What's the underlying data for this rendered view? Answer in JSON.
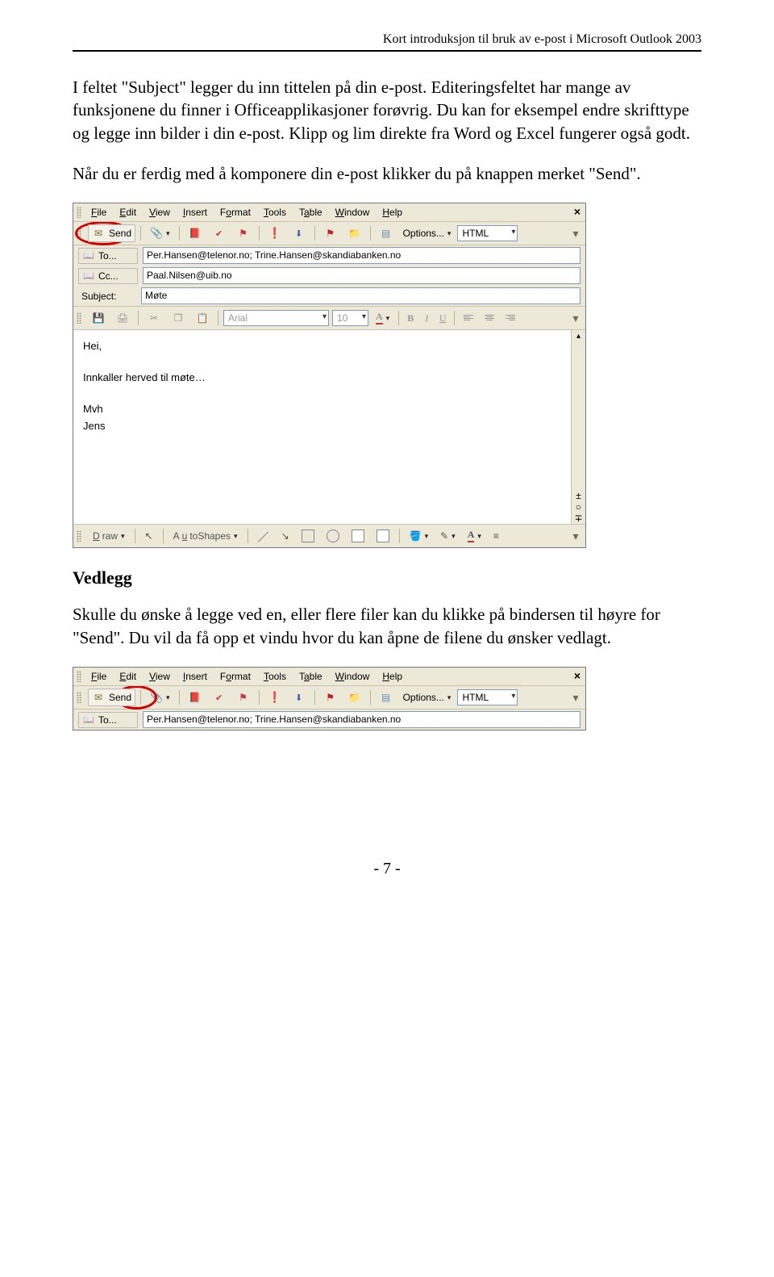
{
  "header": {
    "text": "Kort introduksjon til bruk av e-post i Microsoft Outlook 2003"
  },
  "para1": "I feltet \"Subject\" legger du inn tittelen på din e-post. Editeringsfeltet har mange av funksjonene du finner i Officeapplikasjoner forøvrig. Du kan for eksempel endre skrifttype og legge inn bilder i din e-post. Klipp og lim direkte fra Word og Excel fungerer også godt.",
  "para2": "Når du er ferdig med å komponere din e-post klikker du på knappen merket \"Send\".",
  "section_vedlegg": "Vedlegg",
  "para3": "Skulle du ønske å legge ved en, eller flere filer kan du klikke på bindersen til høyre for \"Send\". Du vil da få opp et vindu hvor du kan åpne de filene du ønsker vedlagt.",
  "footer": "- 7 -",
  "outlook": {
    "menu": {
      "file": {
        "pre": "F",
        "rest": "ile"
      },
      "edit": {
        "pre": "E",
        "rest": "dit"
      },
      "view": {
        "pre": "V",
        "rest": "iew"
      },
      "insert": {
        "pre": "I",
        "rest": "nsert"
      },
      "format": {
        "pre": "F",
        "rest": "ormat"
      },
      "tools": {
        "pre": "T",
        "rest": "ools"
      },
      "table": {
        "pre": "T",
        "rest": "able"
      },
      "window": {
        "pre": "W",
        "rest": "indow"
      },
      "help": {
        "pre": "H",
        "rest": "elp"
      }
    },
    "toolbar": {
      "send": "Send",
      "options": "Options...",
      "html": "HTML"
    },
    "addr": {
      "to_label": "To...",
      "to_value": "Per.Hansen@telenor.no; Trine.Hansen@skandiabanken.no",
      "cc_label": "Cc...",
      "cc_value": "Paal.Nilsen@uib.no",
      "subject_label": "Subject:",
      "subject_value": "Møte"
    },
    "format_bar": {
      "font": "Arial",
      "size": "10"
    },
    "body": {
      "greet": "Hei,",
      "line": "Innkaller herved til møte…",
      "sig1": "Mvh",
      "sig2": "Jens"
    },
    "draw": {
      "draw_label": "Draw",
      "autoshapes": "AutoShapes"
    }
  }
}
